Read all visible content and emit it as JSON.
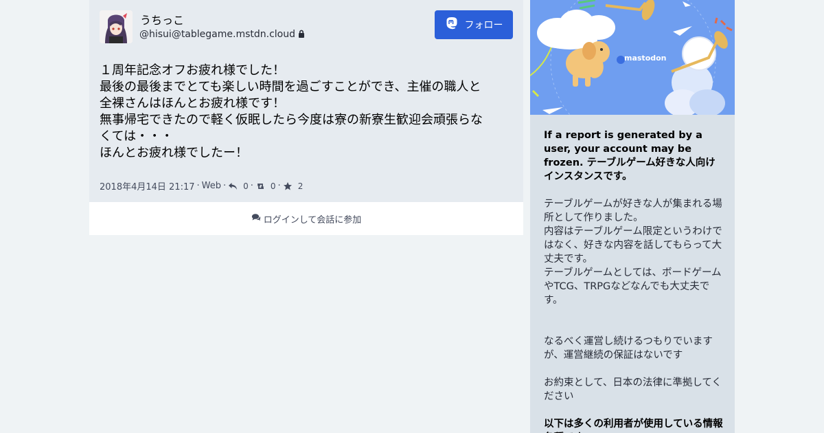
{
  "status": {
    "display_name": "うちっこ",
    "account": "@hisui@tablegame.mstdn.cloud",
    "follow_label": "フォロー",
    "content_lines": [
      "１周年記念オフお疲れ様でした！",
      "最後の最後までとても楽しい時間を過ごすことができ、主催の職人と",
      "全裸さんはほんとお疲れ様です！",
      "無事帰宅できたので軽く仮眠したら今度は寮の新寮生歓迎会頑張らな",
      "くては・・・",
      "ほんとお疲れ様でしたー！"
    ],
    "timestamp": "2018年4月14日 21:17",
    "application": "Web",
    "replies": "0",
    "boosts": "0",
    "favourites": "2"
  },
  "login_prompt": "ログインして会話に参加",
  "sidebar": {
    "hero_logo_text": "mastodon",
    "about_strong": "If a report is generated by a user, your account may be frozen. テーブルゲーム好きな人向けインスタンスです。",
    "about_p1": "テーブルゲームが好きな人が集まれる場所として作りました。",
    "about_p2": "内容はテーブルゲーム限定というわけではなく、好きな内容を話してもらって大丈夫です。",
    "about_p3": "テーブルゲームとしては、ボードゲームやTCG、TRPGなどなんでも大丈夫です。",
    "about_p4": "なるべく運営し続けるつもりでいますが、運営継続の保証はないです",
    "about_p5": "お約束として、日本の法律に準拠してください",
    "about_strong2": "以下は多くの利用者が使用している情報各種です。"
  },
  "colors": {
    "accent": "#2b5fd9",
    "panel": "#e6ebf0",
    "sidebar": "#d9e1e8",
    "hero_bg": "#6f9ef0"
  },
  "icons": {
    "follow": "mastodon-logo-icon",
    "lock": "lock-icon",
    "reply": "reply-icon",
    "boost": "retweet-icon",
    "favourite": "star-icon",
    "comments": "comments-icon"
  }
}
